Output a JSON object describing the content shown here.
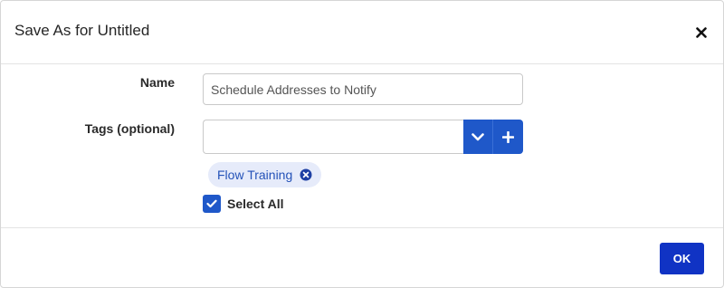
{
  "dialog": {
    "title": "Save As for Untitled",
    "close_icon": "close-icon"
  },
  "form": {
    "name_label": "Name",
    "name_value": "Schedule Addresses to Notify",
    "tags_label": "Tags (optional)",
    "tags_value": "",
    "tags_dropdown_icon": "chevron-down-icon",
    "tags_add_icon": "plus-icon",
    "tags": [
      {
        "label": "Flow Training",
        "remove_icon": "remove-circle-icon"
      }
    ],
    "select_all_label": "Select All",
    "select_all_checked": true
  },
  "footer": {
    "ok_label": "OK"
  },
  "colors": {
    "primary": "#1f58c9",
    "ok_button": "#1033c4",
    "chip_bg": "#e6ebfa",
    "chip_text": "#2452b8"
  }
}
